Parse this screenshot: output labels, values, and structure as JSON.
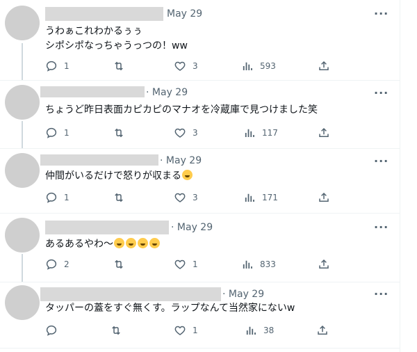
{
  "tweets": [
    {
      "date": "May 29",
      "text_lines": [
        "うわぁこれわかるぅぅ",
        "シポシポなっちゃうっつの！ww"
      ],
      "replies": "1",
      "retweets": "",
      "likes": "3",
      "views": "593"
    },
    {
      "date": "May 29",
      "text_lines": [
        "ちょうど昨日表面カピカピのマナオを冷蔵庫で見つけました笑"
      ],
      "replies": "1",
      "retweets": "",
      "likes": "3",
      "views": "117"
    },
    {
      "date": "May 29",
      "text_lines": [
        "仲間がいるだけで怒りが収まる"
      ],
      "replies": "1",
      "retweets": "",
      "likes": "3",
      "views": "171"
    },
    {
      "date": "May 29",
      "text_lines": [
        "あるあるやわ〜"
      ],
      "replies": "2",
      "retweets": "",
      "likes": "1",
      "views": "833"
    },
    {
      "date": "May 29",
      "text_lines": [
        "タッパーの蓋をすぐ無くす。ラップなんて当然家にないw"
      ],
      "replies": "",
      "retweets": "",
      "likes": "1",
      "views": "38"
    }
  ],
  "icons": [
    "reply-icon",
    "retweet-icon",
    "like-icon",
    "views-icon",
    "share-icon",
    "more-icon"
  ]
}
